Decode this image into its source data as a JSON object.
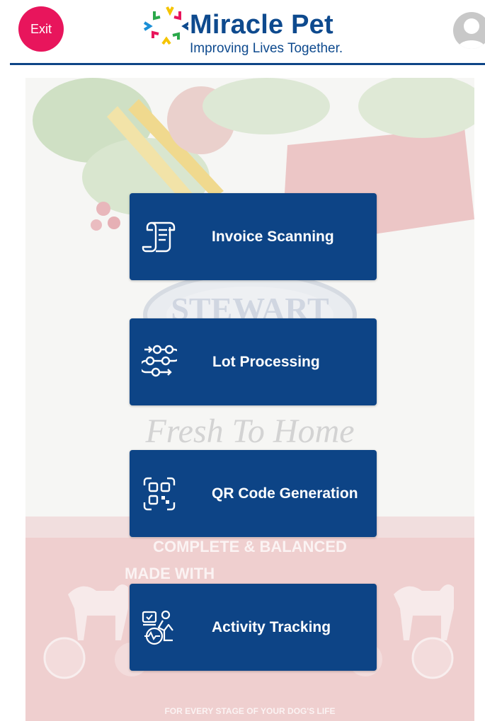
{
  "header": {
    "exit_label": "Exit",
    "logo_title": "Miracle Pet",
    "logo_tagline": "Improving Lives Together."
  },
  "background": {
    "brand": "STEWART",
    "slogan": "Fresh To Home",
    "claim": "COMPLETE & BALANCED",
    "made_with": "MADE WITH",
    "footer": "FOR EVERY STAGE OF YOUR DOG'S LIFE"
  },
  "menu": [
    {
      "label": "Invoice Scanning",
      "icon": "invoice-scroll-icon"
    },
    {
      "label": "Lot Processing",
      "icon": "process-flow-icon"
    },
    {
      "label": "QR Code Generation",
      "icon": "qr-code-icon"
    },
    {
      "label": "Activity Tracking",
      "icon": "activity-tracking-icon"
    }
  ],
  "colors": {
    "primary": "#0d4486",
    "exit": "#e8155c",
    "logo_text": "#0e4a8e"
  }
}
